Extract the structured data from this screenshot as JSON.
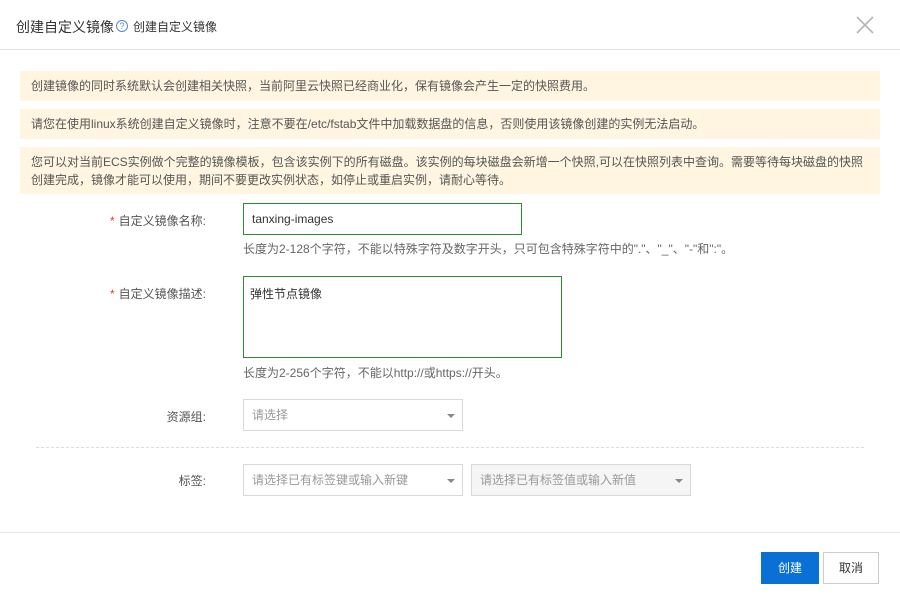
{
  "header": {
    "title": "创建自定义镜像",
    "help_glyph": "?",
    "subtitle": "创建自定义镜像",
    "close_glyph": "×"
  },
  "notices": [
    "创建镜像的同时系统默认会创建相关快照，当前阿里云快照已经商业化，保有镜像会产生一定的快照费用。",
    "请您在使用linux系统创建自定义镜像时，注意不要在/etc/fstab文件中加载数据盘的信息，否则使用该镜像创建的实例无法启动。",
    "您可以对当前ECS实例做个完整的镜像模板，包含该实例下的所有磁盘。该实例的每块磁盘会新增一个快照,可以在快照列表中查询。需要等待每块磁盘的快照创建完成，镜像才能可以使用，期间不要更改实例状态，如停止或重启实例，请耐心等待。"
  ],
  "form": {
    "required_mark": "*",
    "name": {
      "label": "自定义镜像名称:",
      "value": "tanxing-images",
      "hint": "长度为2-128个字符，不能以特殊字符及数字开头，只可包含特殊字符中的\".\"、\"_\"、\"-\"和\":\"。"
    },
    "description": {
      "label": "自定义镜像描述:",
      "value": "弹性节点镜像",
      "hint": "长度为2-256个字符，不能以http://或https://开头。"
    },
    "resource_group": {
      "label": "资源组:",
      "placeholder": "请选择"
    },
    "tags": {
      "label": "标签:",
      "key_placeholder": "请选择已有标签键或输入新键",
      "value_placeholder": "请选择已有标签值或输入新值"
    }
  },
  "footer": {
    "create_label": "创建",
    "cancel_label": "取消"
  },
  "colors": {
    "primary": "#0a70d6",
    "notice_bg": "#fff5e0",
    "valid_border": "#2e8b2e",
    "required": "#e4393c"
  }
}
